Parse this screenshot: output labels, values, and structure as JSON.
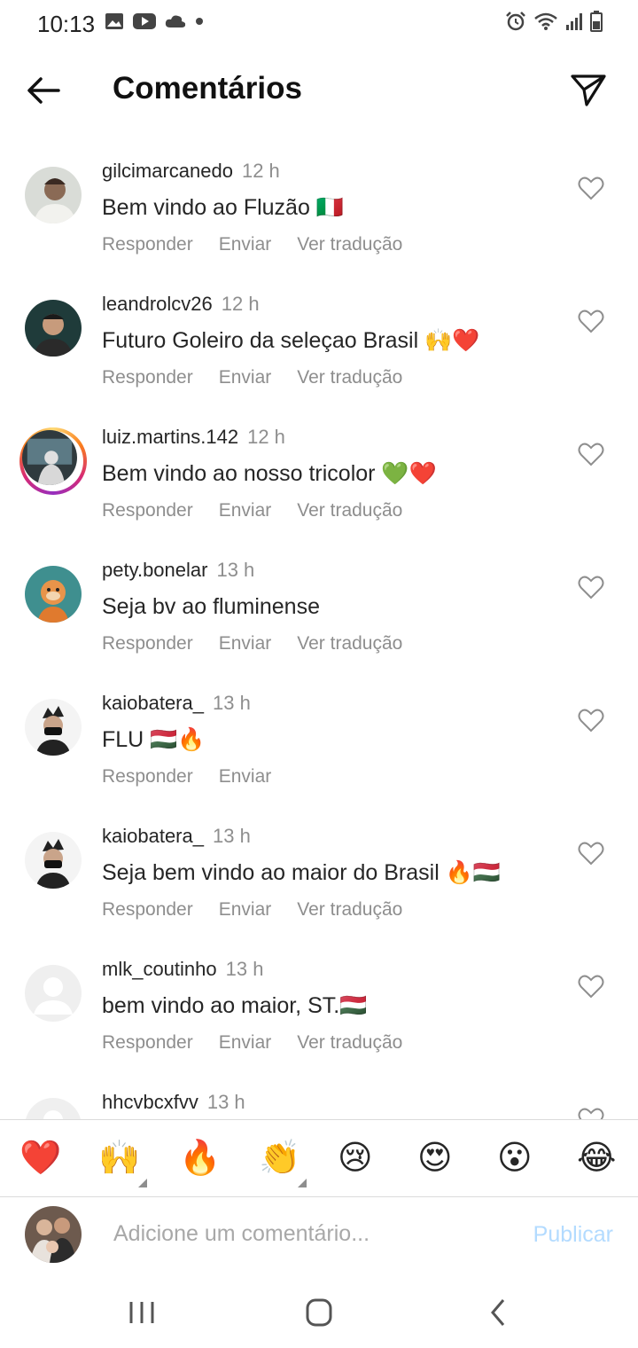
{
  "status": {
    "time": "10:13"
  },
  "header": {
    "title": "Comentários"
  },
  "comments": [
    {
      "username": "gilcimarcanedo",
      "time": "12 h",
      "text": "Bem vindo ao Fluzão 🇮🇹",
      "actions": [
        "Responder",
        "Enviar",
        "Ver tradução"
      ]
    },
    {
      "username": "leandrolcv26",
      "time": "12 h",
      "text": "Futuro Goleiro da seleçao Brasil 🙌❤️",
      "actions": [
        "Responder",
        "Enviar",
        "Ver tradução"
      ]
    },
    {
      "username": "luiz.martins.142",
      "time": "12 h",
      "text": "Bem vindo ao nosso tricolor 💚❤️",
      "actions": [
        "Responder",
        "Enviar",
        "Ver tradução"
      ]
    },
    {
      "username": "pety.bonelar",
      "time": "13 h",
      "text": "Seja bv ao fluminense",
      "actions": [
        "Responder",
        "Enviar",
        "Ver tradução"
      ]
    },
    {
      "username": "kaiobatera_",
      "time": "13 h",
      "text": "FLU 🇭🇺🔥",
      "actions": [
        "Responder",
        "Enviar"
      ]
    },
    {
      "username": "kaiobatera_",
      "time": "13 h",
      "text": "Seja bem vindo ao maior do Brasil 🔥🇭🇺",
      "actions": [
        "Responder",
        "Enviar",
        "Ver tradução"
      ]
    },
    {
      "username": "mlk_coutinho",
      "time": "13 h",
      "text": "bem vindo ao maior, ST.🇭🇺",
      "actions": [
        "Responder",
        "Enviar",
        "Ver tradução"
      ]
    },
    {
      "username": "hhcvbcxfvv",
      "time": "13 h",
      "text": "",
      "actions": []
    }
  ],
  "emoji_bar": [
    "❤️",
    "🙌",
    "🔥",
    "👏",
    "😢",
    "😍",
    "😮",
    "😂"
  ],
  "composer": {
    "placeholder": "Adicione um comentário...",
    "publish_label": "Publicar"
  },
  "colors": {
    "accent_disabled": "#b3dbff",
    "secondary_text": "#8e8e8e",
    "primary_text": "#262626"
  }
}
